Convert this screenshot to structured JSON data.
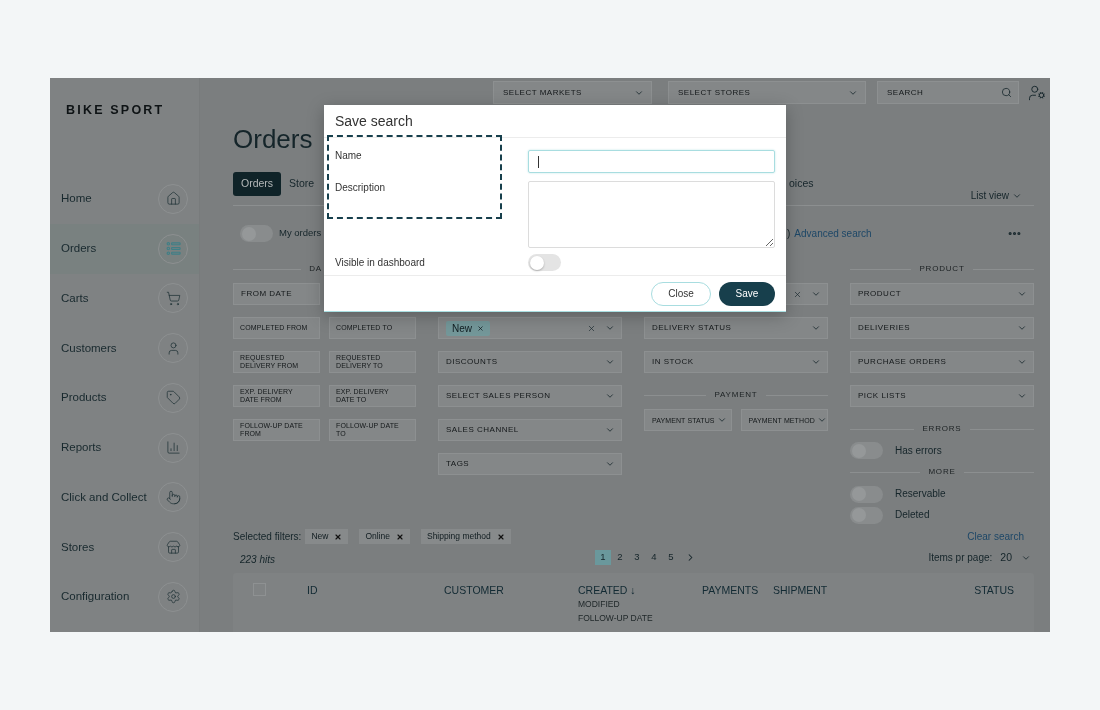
{
  "sidebar": {
    "logo": "BIKE SPORT",
    "items": [
      {
        "label": "Home",
        "selected": false
      },
      {
        "label": "Orders",
        "selected": true
      },
      {
        "label": "Carts",
        "selected": false
      },
      {
        "label": "Customers",
        "selected": false
      },
      {
        "label": "Products",
        "selected": false
      },
      {
        "label": "Reports",
        "selected": false
      },
      {
        "label": "Click and Collect",
        "selected": false
      },
      {
        "label": "Stores",
        "selected": false
      },
      {
        "label": "Configuration",
        "selected": false
      }
    ]
  },
  "top_bar": {
    "markets": {
      "placeholder": "SELECT MARKETS"
    },
    "stores": {
      "placeholder": "SELECT STORES"
    },
    "search": {
      "placeholder": "SEARCH"
    }
  },
  "page": {
    "title": "Orders"
  },
  "tabs": [
    {
      "label": "Orders",
      "selected": true
    },
    {
      "label": "Store",
      "selected": false
    },
    {
      "label": "oices",
      "selected": false
    }
  ],
  "view_switch": {
    "label": "List view"
  },
  "my_orders": {
    "label": "My orders",
    "on": false
  },
  "advanced_search": {
    "paren": ")",
    "label": "Advanced search"
  },
  "filters": {
    "date": {
      "heading": "DA",
      "from_date": {
        "placeholder": "FROM DATE"
      },
      "ranges": [
        {
          "from": "COMPLETED FROM",
          "to": "COMPLETED TO"
        },
        {
          "from": "REQUESTED DELIVERY FROM",
          "to": "REQUESTED DELIVERY TO"
        },
        {
          "from": "EXP. DELIVERY DATE FROM",
          "to": "EXP. DELIVERY DATE TO"
        },
        {
          "from": "FOLLOW-UP DATE FROM",
          "to": "FOLLOW-UP DATE TO"
        }
      ]
    },
    "order": {
      "status_tags": [
        "New"
      ],
      "selects": [
        {
          "placeholder": "DISCOUNTS"
        },
        {
          "placeholder": "SELECT SALES PERSON"
        },
        {
          "placeholder": "SALES CHANNEL"
        },
        {
          "placeholder": "TAGS"
        }
      ]
    },
    "delivery": {
      "selects": [
        {
          "placeholder": "DELIVERY STATUS"
        },
        {
          "placeholder": "IN STOCK"
        }
      ],
      "payment": {
        "heading": "PAYMENT",
        "selects": [
          {
            "placeholder": "PAYMENT STATUS"
          },
          {
            "placeholder": "PAYMENT METHOD"
          }
        ]
      }
    },
    "product": {
      "heading": "PRODUCT",
      "selects": [
        {
          "placeholder": "PRODUCT"
        },
        {
          "placeholder": "DELIVERIES"
        },
        {
          "placeholder": "PURCHASE ORDERS"
        },
        {
          "placeholder": "PICK LISTS"
        }
      ],
      "errors": {
        "heading": "ERRORS",
        "toggles": [
          {
            "label": "Has errors",
            "on": false
          }
        ]
      },
      "more": {
        "heading": "MORE",
        "toggles": [
          {
            "label": "Reservable",
            "on": false
          },
          {
            "label": "Deleted",
            "on": false
          }
        ]
      }
    }
  },
  "selected_filters": {
    "label": "Selected filters:",
    "chips": [
      "New",
      "Online",
      "Shipping method"
    ],
    "clear": "Clear search"
  },
  "results": {
    "hits": "223 hits",
    "pages": [
      {
        "label": "1",
        "selected": true
      },
      {
        "label": "2",
        "selected": false
      },
      {
        "label": "3",
        "selected": false
      },
      {
        "label": "4",
        "selected": false
      },
      {
        "label": "5",
        "selected": false
      }
    ],
    "per_page_label": "Items pr page:",
    "per_page": "20"
  },
  "table": {
    "select_all": {
      "checked": false
    },
    "columns": [
      {
        "label": "ID"
      },
      {
        "label": "CUSTOMER"
      },
      {
        "label": "CREATED ↓",
        "sublabels": [
          "MODIFIED",
          "FOLLOW-UP DATE"
        ]
      },
      {
        "label": "PAYMENTS"
      },
      {
        "label": "SHIPMENT"
      },
      {
        "label": "STATUS"
      }
    ]
  },
  "dialog": {
    "title": "Save search",
    "name": {
      "label": "Name"
    },
    "description": {
      "label": "Description"
    },
    "visible": {
      "label": "Visible in dashboard",
      "on": false
    },
    "buttons": [
      {
        "label": "Close",
        "kind": "secondary"
      },
      {
        "label": "Save",
        "kind": "primary"
      }
    ]
  }
}
